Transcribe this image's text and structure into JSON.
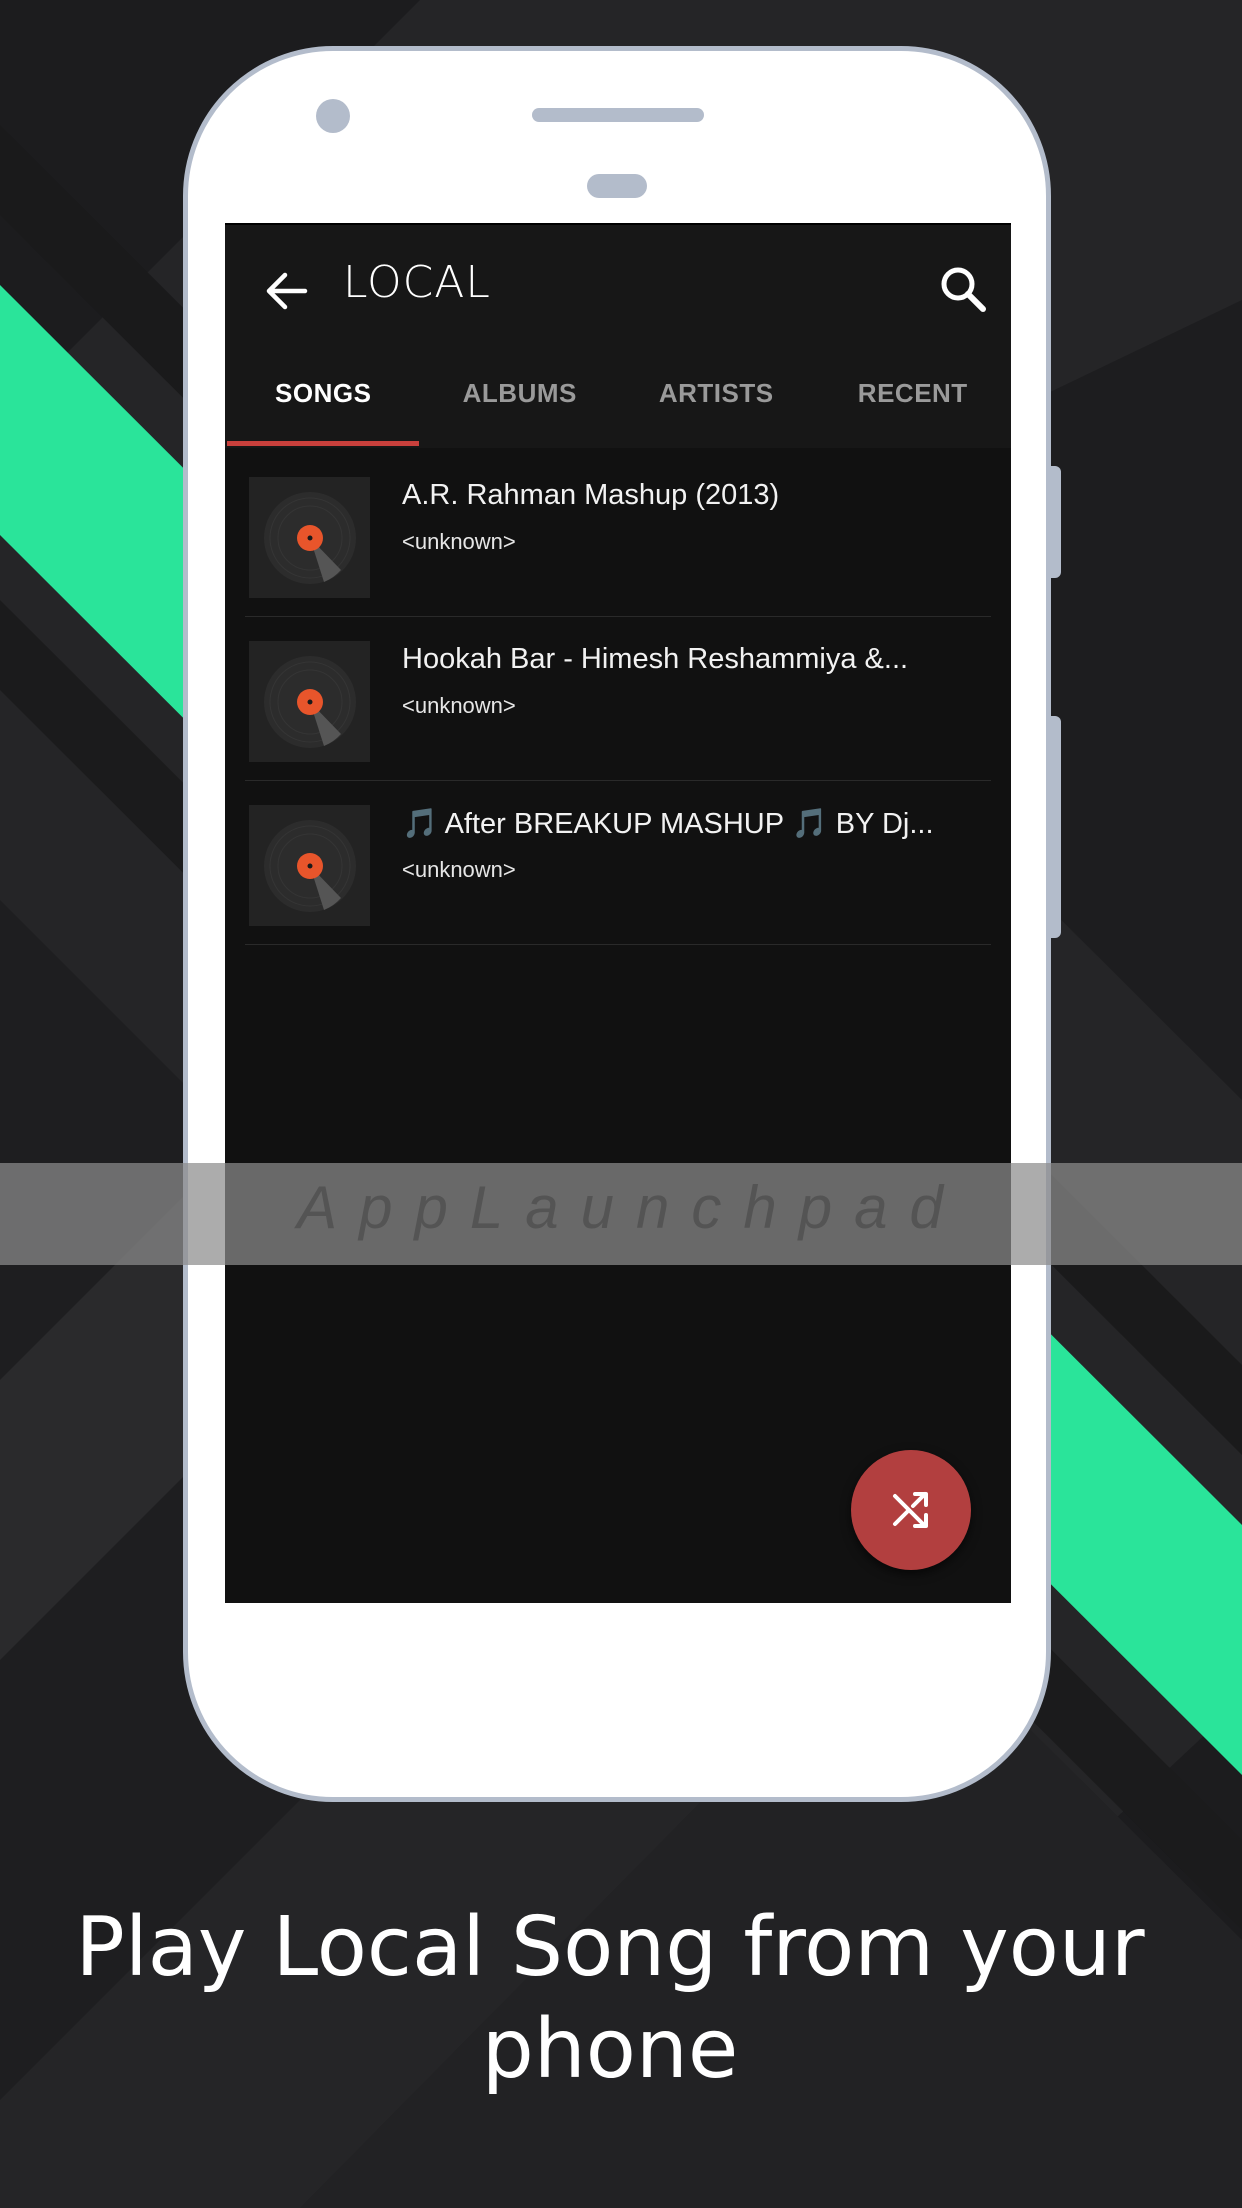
{
  "colors": {
    "accent": "#c9403c",
    "fab": "#b23f3f",
    "stripe": "#2ae49a",
    "disc_label": "#e8552b",
    "phone_frame": "#b3bccb"
  },
  "toolbar": {
    "back_icon": "arrow-left-icon",
    "title": "LOCAL",
    "search_icon": "search-icon"
  },
  "tabs": [
    {
      "label": "SONGS",
      "active": true
    },
    {
      "label": "ALBUMS",
      "active": false
    },
    {
      "label": "ARTISTS",
      "active": false
    },
    {
      "label": "RECENT",
      "active": false
    }
  ],
  "songs": [
    {
      "title": "A.R. Rahman Mashup (2013)",
      "artist": "<unknown>"
    },
    {
      "title": "Hookah Bar - Himesh Reshammiya &...",
      "artist": "<unknown>"
    },
    {
      "title": "🎵 After BREAKUP MASHUP 🎵 BY Dj...",
      "artist": "<unknown>"
    }
  ],
  "fab": {
    "icon": "shuffle-icon"
  },
  "watermark": "AppLaunchpad",
  "caption": "Play Local Song from your phone"
}
